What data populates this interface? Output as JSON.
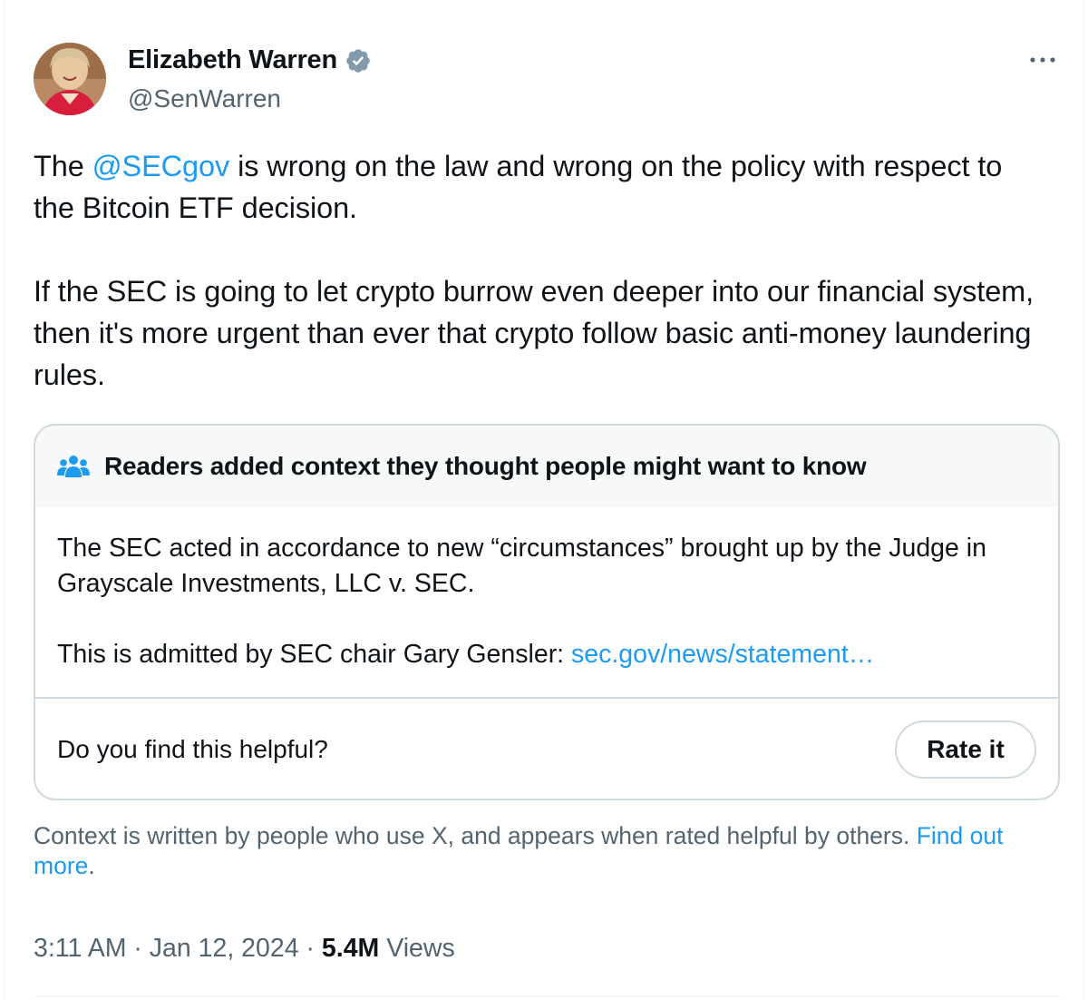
{
  "author": {
    "display_name": "Elizabeth Warren",
    "handle": "@SenWarren",
    "avatar_icon": "profile-photo",
    "verified_icon": "verified-badge-icon"
  },
  "tweet": {
    "p1_prefix": "The ",
    "p1_mention": "@SECgov",
    "p1_suffix": " is wrong on the law and wrong on the policy with respect to the Bitcoin ETF decision.",
    "p2": "If the SEC is going to let crypto burrow even deeper into our financial system, then it's more urgent than ever that crypto follow basic anti-money laundering rules."
  },
  "community_note": {
    "icon": "people-icon",
    "header": "Readers added context they thought people might want to know",
    "body_1": "The SEC acted in accordance to new “circumstances” brought up by the Judge in Grayscale Investments, LLC v. SEC.",
    "body_2_prefix": "This is admitted by SEC chair Gary Gensler: ",
    "body_2_link": "sec.gov/news/statement…",
    "helpful_question": "Do you find this helpful?",
    "rate_button": "Rate it"
  },
  "context_note": {
    "text": "Context is written by people who use X, and appears when rated helpful by others. ",
    "link": "Find out more",
    "suffix": "."
  },
  "meta": {
    "time": "3:11 AM",
    "separator_1": " · ",
    "date": "Jan 12, 2024",
    "separator_2": " · ",
    "views_count": "5.4M",
    "views_label": " Views"
  },
  "colors": {
    "link": "#1d9bf0",
    "secondary_text": "#536471",
    "primary_text": "#0f1419",
    "border": "#cfd9de"
  }
}
